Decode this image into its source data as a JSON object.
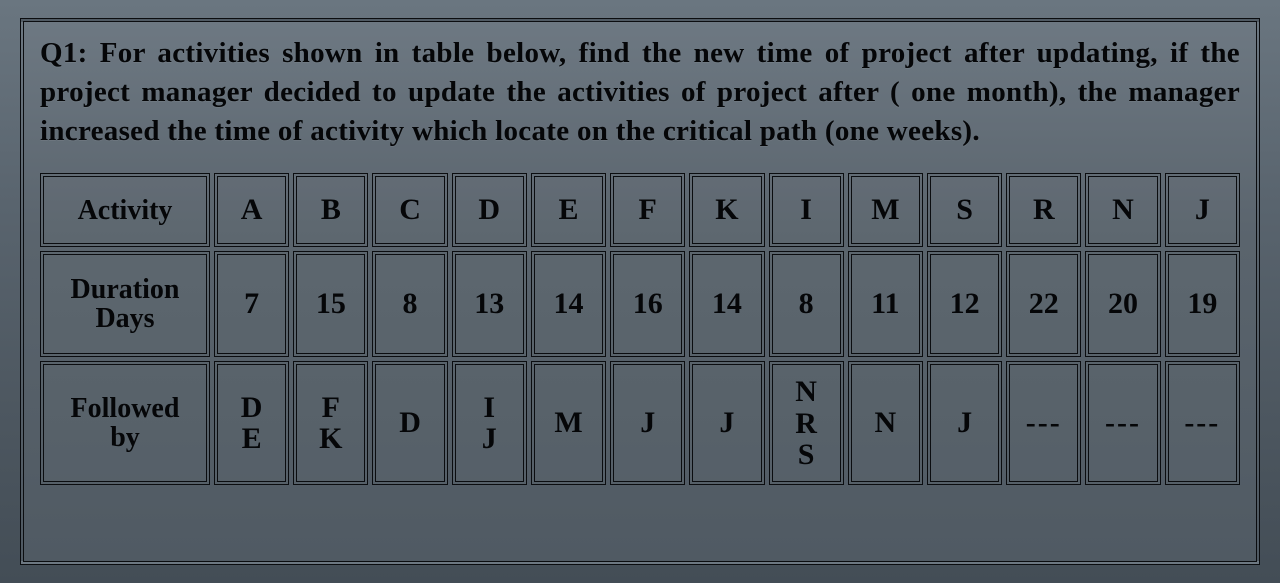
{
  "question": {
    "label": "Q1:",
    "text": "For activities shown in table below, find the new time of project after updating, if the project manager decided to update the activities of project after ( one month), the manager increased the time of activity which locate on the critical path (one weeks)."
  },
  "table": {
    "row_headers": {
      "activity": "Activity",
      "duration_l1": "Duration",
      "duration_l2": "Days",
      "followed_l1": "Followed",
      "followed_l2": "by"
    },
    "columns": [
      "A",
      "B",
      "C",
      "D",
      "E",
      "F",
      "K",
      "I",
      "M",
      "S",
      "R",
      "N",
      "J"
    ],
    "duration_days": [
      7,
      15,
      8,
      13,
      14,
      16,
      14,
      8,
      11,
      12,
      22,
      20,
      19
    ],
    "followed_by": [
      [
        "D",
        "E"
      ],
      [
        "F",
        "K"
      ],
      [
        "D"
      ],
      [
        "I",
        "J"
      ],
      [
        "M"
      ],
      [
        "J"
      ],
      [
        "J"
      ],
      [
        "N",
        "R",
        "S"
      ],
      [
        "N"
      ],
      [
        "J"
      ],
      [
        "---"
      ],
      [
        "---"
      ],
      [
        "---"
      ]
    ]
  },
  "chart_data": {
    "type": "table",
    "title": "Activity network data",
    "columns": [
      "Activity",
      "Duration Days",
      "Followed by"
    ],
    "rows": [
      {
        "Activity": "A",
        "Duration Days": 7,
        "Followed by": "D, E"
      },
      {
        "Activity": "B",
        "Duration Days": 15,
        "Followed by": "F, K"
      },
      {
        "Activity": "C",
        "Duration Days": 8,
        "Followed by": "D"
      },
      {
        "Activity": "D",
        "Duration Days": 13,
        "Followed by": "I, J"
      },
      {
        "Activity": "E",
        "Duration Days": 14,
        "Followed by": "M"
      },
      {
        "Activity": "F",
        "Duration Days": 16,
        "Followed by": "J"
      },
      {
        "Activity": "K",
        "Duration Days": 14,
        "Followed by": "J"
      },
      {
        "Activity": "I",
        "Duration Days": 8,
        "Followed by": "N, R, S"
      },
      {
        "Activity": "M",
        "Duration Days": 11,
        "Followed by": "N"
      },
      {
        "Activity": "S",
        "Duration Days": 12,
        "Followed by": "J"
      },
      {
        "Activity": "R",
        "Duration Days": 22,
        "Followed by": "---"
      },
      {
        "Activity": "N",
        "Duration Days": 20,
        "Followed by": "---"
      },
      {
        "Activity": "J",
        "Duration Days": 19,
        "Followed by": "---"
      }
    ]
  }
}
